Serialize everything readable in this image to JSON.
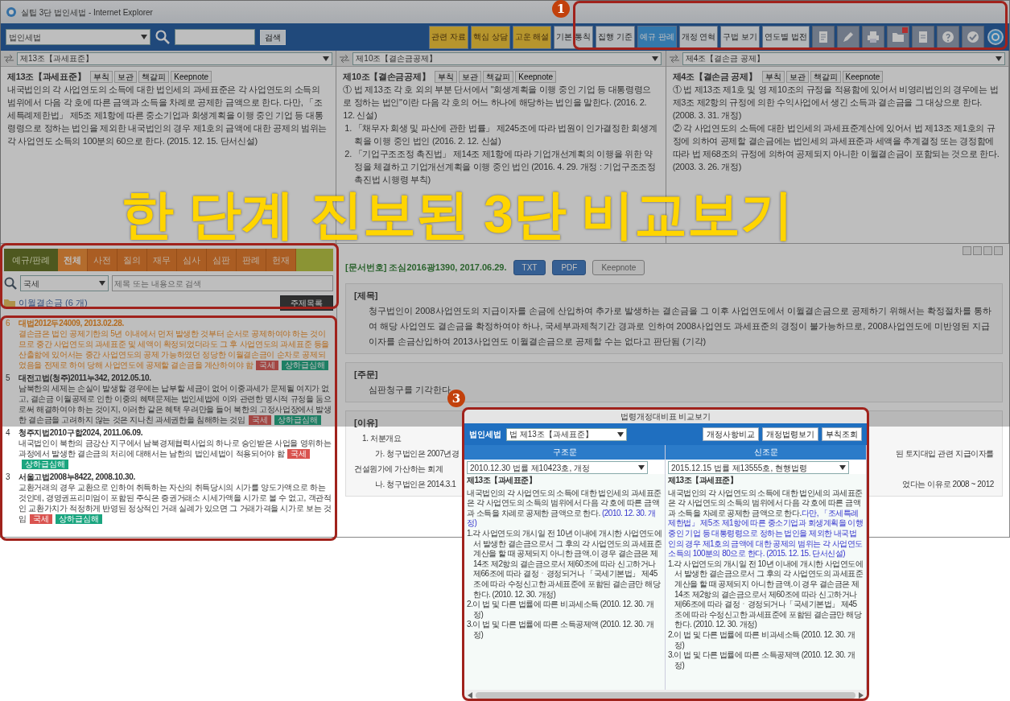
{
  "window": {
    "title": "실팁 3단 법인세법 - Internet Explorer"
  },
  "toolbar": {
    "law_select": "법인세법",
    "search_button": "검색",
    "tools": [
      {
        "label": "관련 자료",
        "kind": "featured",
        "selected": false
      },
      {
        "label": "핵심 상담",
        "kind": "featured",
        "selected": false
      },
      {
        "label": "고운 해설",
        "kind": "featured",
        "selected": false
      },
      {
        "label": "기본 통칙",
        "kind": "normal",
        "selected": false
      },
      {
        "label": "집행 기준",
        "kind": "normal",
        "selected": false
      },
      {
        "label": "예규 판례",
        "kind": "normal",
        "selected": true
      },
      {
        "label": "개정 연혁",
        "kind": "normal",
        "selected": false
      },
      {
        "label": "구법 보기",
        "kind": "normal",
        "selected": false
      },
      {
        "label": "연도별 법전",
        "kind": "normal",
        "selected": false
      }
    ]
  },
  "panels": [
    {
      "select": "제13조【과세표준】",
      "title": "제13조【과세표준】",
      "actions": [
        "부칙",
        "보관",
        "책갈피",
        "Keepnote"
      ],
      "paragraphs": [
        {
          "kind": "para",
          "text": "내국법인의 각 사업연도의 소득에 대한 법인세의 과세표준은 각 사업연도의 소득의 범위에서 다음 각 호에 따른 금액과 소득을 차례로 공제한 금액으로 한다. 다만, 「조세특례제한법」 제5조 제1항에 따른 중소기업과 회생계획을 이행 중인 기업 등 대통령령으로 정하는 법인을 제외한 내국법인의 경우 제1호의 금액에 대한 공제의 범위는 각 사업연도 소득의 100분의 60으로 한다. (2015. 12. 15. 단서신설)"
        }
      ]
    },
    {
      "select": "제10조【결손금공제】",
      "title": "제10조【결손금공제】",
      "actions": [
        "부칙",
        "보관",
        "책갈피",
        "Keepnote"
      ],
      "paragraphs": [
        {
          "kind": "para",
          "text": "① 법 제13조 각 호 외의 부분 단서에서 \"회생계획을 이행 중인 기업 등 대통령령으로 정하는 법인\"이란 다음 각 호의 어느 하나에 해당하는 법인을 말한다. (2016. 2. 12. 신설)"
        },
        {
          "kind": "item",
          "text": "1. 「채무자 회생 및 파산에 관한 법률」 제245조에 따라 법원이 인가결정한 회생계획을 이행 중인 법인 (2016. 2. 12. 신설)"
        },
        {
          "kind": "item",
          "text": "2. 「기업구조조정 촉진법」 제14조 제1항에 따라 기업개선계획의 이행을 위한 약정을 체결하고 기업개선계획을 이행 중인 법인 (2016. 4. 29. 개정 : 기업구조조정촉진법 시행령 부칙)"
        }
      ]
    },
    {
      "select": "제4조【결손금 공제】",
      "title": "제4조【결손금 공제】",
      "actions": [
        "부칙",
        "보관",
        "책갈피",
        "Keepnote"
      ],
      "paragraphs": [
        {
          "kind": "para",
          "text": "① 법 제13조 제1호 및 영 제10조의 규정을 적용함에 있어서 비영리법인의 경우에는 법 제3조 제2항의 규정에 의한 수익사업에서 생긴 소득과 결손금을 그 대상으로 한다. (2008. 3. 31. 개정)"
        },
        {
          "kind": "para",
          "text": "② 각 사업연도의 소득에 대한 법인세의 과세표준계산에 있어서 법 제13조 제1호의 규정에 의하여 공제할 결손금에는 법인세의 과세표준과 세액을 추계결정 또는 경정함에 따라 법 제68조의 규정에 의하여 공제되지 아니한 이월결손금이 포함되는 것으로 한다. (2003. 3. 26. 개정)"
        }
      ]
    }
  ],
  "rulings": {
    "category": "예규/판례",
    "tabs": [
      {
        "label": "전체",
        "selected": true
      },
      {
        "label": "사전",
        "selected": false
      },
      {
        "label": "질의",
        "selected": false
      },
      {
        "label": "재무",
        "selected": false
      },
      {
        "label": "심사",
        "selected": false
      },
      {
        "label": "심판",
        "selected": false
      },
      {
        "label": "판례",
        "selected": false
      },
      {
        "label": "헌재",
        "selected": false
      }
    ],
    "scope_select": "국세",
    "search_placeholder": "제목 또는 내용으로 검색",
    "folder": "이월결손금 (6 개)",
    "topic_button": "주제목록",
    "items": [
      {
        "number": "6",
        "title": "대법2012두24009, 2013.02.28.",
        "selected": true,
        "summary": "결손금은 법인 공제기한의 5년 이내에서 먼저 발생한 것부터 순서로 공제하여야 하는 것이므로 중간 사업연도의 과세표준 및 세액이 확정되었더라도 그 후 사업연도의 과세표준 등을 산출함에 있어서는 중간 사업연도의 공제 가능하였던 정당한 이월결손금이 순차로 공제되었음을 전제로 하여 당해 사업연도에 공제할 결손금을 계산하여야 함",
        "tags": [
          {
            "label": "국세",
            "kind": "tax"
          },
          {
            "label": "상하급심해",
            "kind": "court"
          }
        ]
      },
      {
        "number": "5",
        "title": "대전고법(청주)2011누342, 2012.05.10.",
        "selected": false,
        "summary": "남북한의 세제는 손실이 발생할 경우에는 납부할 세금이 없어 이중과세가 문제될 여지가 없고, 결손금 이월공제로 인한 이중의 혜택문제는 법인세법에 이와 관련한 명시적 규정을 둠으로써 해결하여야 하는 것이지, 이러한 같은 혜택 우려만을 들어 북한의 고정사업장에서 발생한 결손금을 고려하지 않는 것은 지나친 과세권한을 침해하는 것임",
        "tags": [
          {
            "label": "국세",
            "kind": "tax"
          },
          {
            "label": "상하급심해",
            "kind": "court"
          }
        ]
      },
      {
        "number": "4",
        "title": "청주지법2010구합2024, 2011.06.09.",
        "selected": false,
        "summary": "내국법인이 북한의 금강산 지구에서 남북경제협력사업의 하나로 승인받은 사업을 영위하는 과정에서 발생한 결손금의 처리에 대해서는 남한의 법인세법이 적용되어야 함",
        "tags": [
          {
            "label": "국세",
            "kind": "tax"
          },
          {
            "label": "상하급심해",
            "kind": "court"
          }
        ]
      },
      {
        "number": "3",
        "title": "서울고법2008누8422, 2008.10.30.",
        "selected": false,
        "summary": "교환거래의 경우 교환으로 인하여 취득하는 자산의 취득당시의 시가를 양도가액으로 하는 것인데, 경영권프리미엄이 포함된 주식은 증권거래소 시세가액을 시가로 볼 수 없고, 객관적인 교환가치가 적정하게 반영된 정상적인 거래 실례가 있으면 그 거래가격을 시가로 보는 것임",
        "tags": [
          {
            "label": "국세",
            "kind": "tax"
          },
          {
            "label": "상하급심해",
            "kind": "court"
          }
        ]
      }
    ]
  },
  "document": {
    "number": "[문서번호] 조심2016광1390, 2017.06.29.",
    "buttons": [
      {
        "label": "TXT",
        "kind": "file"
      },
      {
        "label": "PDF",
        "kind": "file"
      },
      {
        "label": "Keepnote",
        "kind": "note"
      }
    ],
    "sections": [
      {
        "heading": "[제목]",
        "lines": [
          {
            "kind": "para",
            "left": "청구법인이 2008사업연도의 지급이자를 손금에 산입하여 추가로 발생하는 결손금을 그 이후 사업연도에서 이월결손금으로 공제하기 위해서는 확정절차를 통하여 해당 사업연도 결손금을 확정하여야 하나, 국세부과제척기간 경과로 인하여 2008사업연도 과세표준의 경정이 불가능하므로, 2008사업연도에 미반영된 지급이자를 손금산입하여 2013사업연도 이월결손금으로 공제할 수는 없다고 판단됨 (기각)"
          }
        ]
      },
      {
        "heading": "[주문]",
        "lines": [
          {
            "kind": "para",
            "left": "심판청구를 기각한다."
          }
        ]
      },
      {
        "heading": "[이유]",
        "lines": [
          {
            "kind": "heading",
            "left": "1. 처분개요"
          },
          {
            "kind": "sub",
            "left": "가. 청구법인은 2007년경",
            "right": "된 토지대입 관련 지급이자를"
          },
          {
            "kind": "cont",
            "left": "건설원가에 가산하는 회계"
          },
          {
            "kind": "sub",
            "left": "나. 청구법인은 2014.3.1",
            "right": "었다는 이유로 2008 ~ 2012"
          }
        ]
      }
    ]
  },
  "popup": {
    "title": "법령개정대비표 비교보기",
    "law": "법인세법",
    "select": "법 제13조【과세표준】",
    "buttons": [
      "개정사항비교",
      "개정법령보기",
      "부칙조회"
    ],
    "columns": [
      {
        "heading": "구조문",
        "version": "2010.12.30 법률 제10423호, 개정",
        "title": "제13조【과세표준】",
        "paragraphs": [
          [
            {
              "text": "내국법인의 각 사업연도의 소득에 대한 법인세의 과세표준은 각 사업연도의 소득의 범위에서 다음 각 호에 따른 금액과 소득을 차례로 공제한 금액으로 한다. ",
              "changed": false
            },
            {
              "text": "(2010. 12. 30. 개정)",
              "changed": true
            }
          ],
          [
            {
              "text": "1.각 사업연도의 개시일 전 10년 이내에 개시한 사업연도에서 발생한 결손금으로서 그 후의 각 사업연도의 과세표준 계산을 할 때 공제되지 아니한 금액.이 경우 결손금은 제14조 제2항의 결손금으로서 제60조에 따라 신고하거나 제66조에 따라 결정ㆍ경정되거나 「국세기본법」 제45조에 따라 수정신고한 과세표준에 포함된 결손금만 해당한다. (2010. 12. 30. 개정)",
              "changed": false
            }
          ],
          [
            {
              "text": "2.이 법 및 다른 법률에 따른 비과세소득 (2010. 12. 30. 개정)",
              "changed": false
            }
          ],
          [
            {
              "text": "3.이 법 및 다른 법률에 따른 소득공제액 (2010. 12. 30. 개정)",
              "changed": false
            }
          ]
        ]
      },
      {
        "heading": "신조문",
        "version": "2015.12.15 법률 제13555호, 현행법령",
        "title": "제13조【과세표준】",
        "paragraphs": [
          [
            {
              "text": "내국법인의 각 사업연도의 소득에 대한 법인세의 과세표준은 각 사업연도의 소득의 범위에서 다음 각 호에 따른 금액과 소득을 차례로 공제한 금액으로 한다.",
              "changed": false
            },
            {
              "text": "다만, 「조세특례제한법」 제5조 제1항에 따른 중소기업과 회생계획을 이행 중인 기업 등 대통령령으로 정하는 법인을 제외한 내국법인의 경우 제1호의 금액에 대한 공제의 범위는 각 사업연도 소득의 100분의 80으로 한다. (2015. 12. 15. 단서신설)",
              "changed": true
            }
          ],
          [
            {
              "text": "1.각 사업연도의 개시일 전 10년 이내에 개시한 사업연도에서 발생한 결손금으로서 그 후의 각 사업연도의 과세표준 계산을 할 때 공제되지 아니한 금액.이 경우 결손금은 제14조 제2항의 결손금으로서 제60조에 따라 신고하거나 제66조에 따라 결정ㆍ경정되거나「국세기본법」 제45조에 따라 수정신고한 과세표준에 포함된 결손금만 해당한다. (2010. 12. 30. 개정)",
              "changed": false
            }
          ],
          [
            {
              "text": "2.이 법 및 다른 법률에 따른 비과세소득 (2010. 12. 30. 개정)",
              "changed": false
            }
          ],
          [
            {
              "text": "3.이 법 및 다른 법률에 따른 소득공제액 (2010. 12. 30. 개정)",
              "changed": false
            }
          ]
        ]
      }
    ]
  },
  "annotations": {
    "banner": "한 단계 진보된 3단 비교보기",
    "markers": [
      "1",
      "3"
    ]
  }
}
